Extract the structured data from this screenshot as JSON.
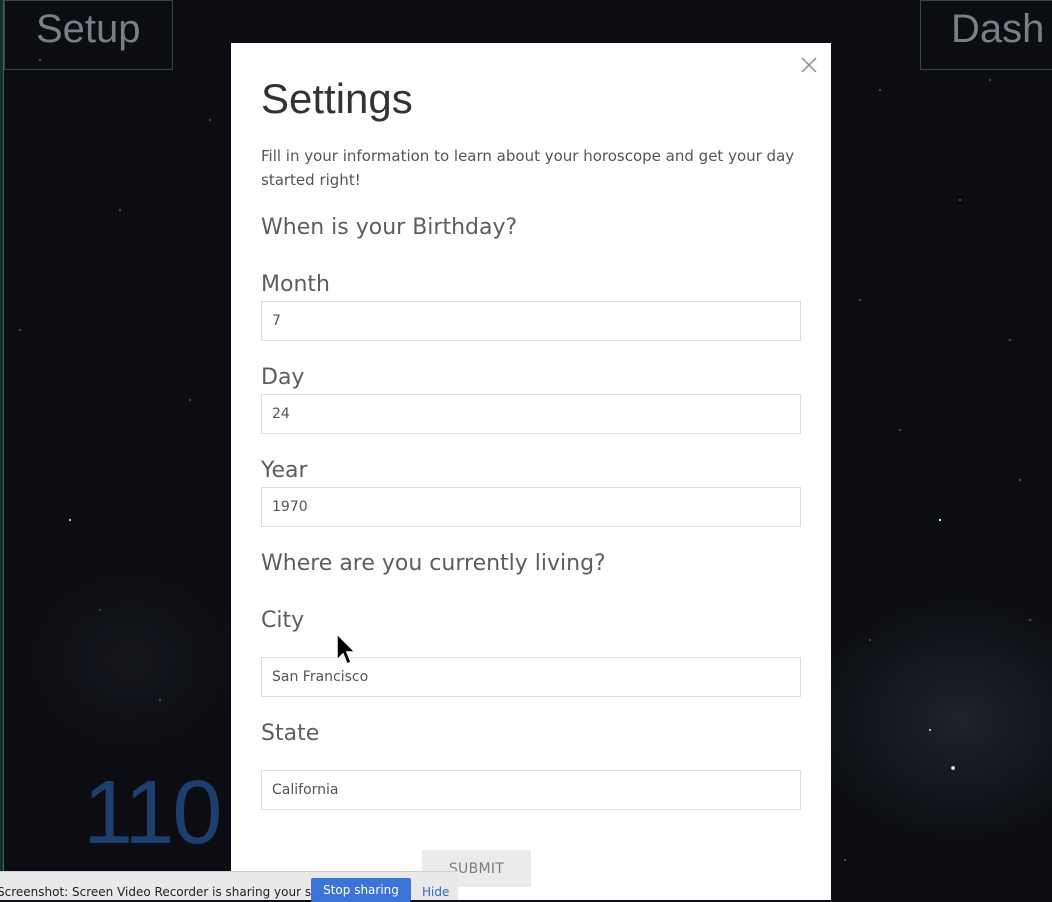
{
  "background": {
    "tiles": {
      "left_label": "Setup",
      "right_label": "Dash"
    },
    "big_number": "110"
  },
  "modal": {
    "title": "Settings",
    "intro": "Fill in your information to learn about your horoscope and get your day started right!",
    "close_icon": "close-icon",
    "birthday_heading": "When is your Birthday?",
    "fields": {
      "month": {
        "label": "Month",
        "value": "7"
      },
      "day": {
        "label": "Day",
        "value": "24"
      },
      "year": {
        "label": "Year",
        "value": "1970"
      }
    },
    "location_heading": "Where are you currently living?",
    "location": {
      "city": {
        "label": "City",
        "value": "San Francisco"
      },
      "state": {
        "label": "State",
        "value": "California"
      }
    },
    "submit_label": "SUBMIT"
  },
  "share_bar": {
    "message": "Screenshot: Screen Video Recorder is sharing your screen.",
    "stop_label": "Stop sharing",
    "hide_label": "Hide"
  },
  "colors": {
    "modal_bg": "#ffffff",
    "text_dark": "#333333",
    "text_muted": "#5e5e5e",
    "input_border": "#dcdcdc",
    "button_bg": "#ebebeb",
    "share_button": "#3b73d6",
    "big_number": "#1d3f6f"
  }
}
